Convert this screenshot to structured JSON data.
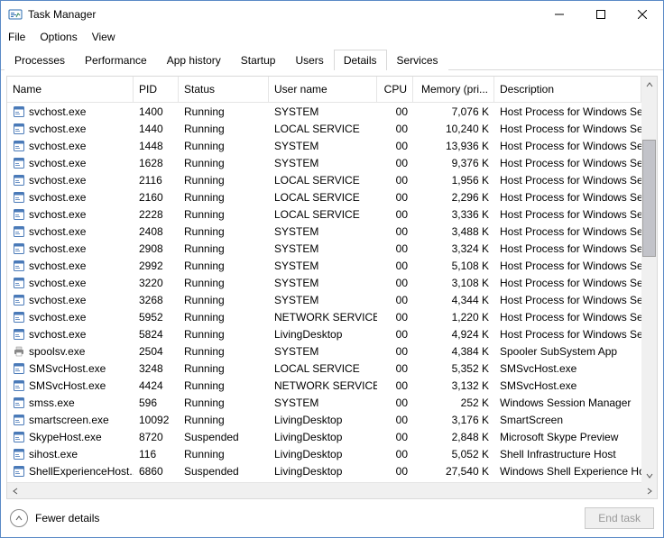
{
  "window": {
    "title": "Task Manager"
  },
  "menu": {
    "file": "File",
    "options": "Options",
    "view": "View"
  },
  "tabs": {
    "processes": "Processes",
    "performance": "Performance",
    "app_history": "App history",
    "startup": "Startup",
    "users": "Users",
    "details": "Details",
    "services": "Services"
  },
  "columns": {
    "name": "Name",
    "pid": "PID",
    "status": "Status",
    "user": "User name",
    "cpu": "CPU",
    "memory": "Memory (pri...",
    "description": "Description"
  },
  "rows": [
    {
      "icon": "exe",
      "name": "svchost.exe",
      "pid": "1400",
      "status": "Running",
      "user": "SYSTEM",
      "cpu": "00",
      "mem": "7,076 K",
      "desc": "Host Process for Windows Serv"
    },
    {
      "icon": "exe",
      "name": "svchost.exe",
      "pid": "1440",
      "status": "Running",
      "user": "LOCAL SERVICE",
      "cpu": "00",
      "mem": "10,240 K",
      "desc": "Host Process for Windows Serv"
    },
    {
      "icon": "exe",
      "name": "svchost.exe",
      "pid": "1448",
      "status": "Running",
      "user": "SYSTEM",
      "cpu": "00",
      "mem": "13,936 K",
      "desc": "Host Process for Windows Serv"
    },
    {
      "icon": "exe",
      "name": "svchost.exe",
      "pid": "1628",
      "status": "Running",
      "user": "SYSTEM",
      "cpu": "00",
      "mem": "9,376 K",
      "desc": "Host Process for Windows Serv"
    },
    {
      "icon": "exe",
      "name": "svchost.exe",
      "pid": "2116",
      "status": "Running",
      "user": "LOCAL SERVICE",
      "cpu": "00",
      "mem": "1,956 K",
      "desc": "Host Process for Windows Serv"
    },
    {
      "icon": "exe",
      "name": "svchost.exe",
      "pid": "2160",
      "status": "Running",
      "user": "LOCAL SERVICE",
      "cpu": "00",
      "mem": "2,296 K",
      "desc": "Host Process for Windows Serv"
    },
    {
      "icon": "exe",
      "name": "svchost.exe",
      "pid": "2228",
      "status": "Running",
      "user": "LOCAL SERVICE",
      "cpu": "00",
      "mem": "3,336 K",
      "desc": "Host Process for Windows Serv"
    },
    {
      "icon": "exe",
      "name": "svchost.exe",
      "pid": "2408",
      "status": "Running",
      "user": "SYSTEM",
      "cpu": "00",
      "mem": "3,488 K",
      "desc": "Host Process for Windows Serv"
    },
    {
      "icon": "exe",
      "name": "svchost.exe",
      "pid": "2908",
      "status": "Running",
      "user": "SYSTEM",
      "cpu": "00",
      "mem": "3,324 K",
      "desc": "Host Process for Windows Serv"
    },
    {
      "icon": "exe",
      "name": "svchost.exe",
      "pid": "2992",
      "status": "Running",
      "user": "SYSTEM",
      "cpu": "00",
      "mem": "5,108 K",
      "desc": "Host Process for Windows Serv"
    },
    {
      "icon": "exe",
      "name": "svchost.exe",
      "pid": "3220",
      "status": "Running",
      "user": "SYSTEM",
      "cpu": "00",
      "mem": "3,108 K",
      "desc": "Host Process for Windows Serv"
    },
    {
      "icon": "exe",
      "name": "svchost.exe",
      "pid": "3268",
      "status": "Running",
      "user": "SYSTEM",
      "cpu": "00",
      "mem": "4,344 K",
      "desc": "Host Process for Windows Serv"
    },
    {
      "icon": "exe",
      "name": "svchost.exe",
      "pid": "5952",
      "status": "Running",
      "user": "NETWORK SERVICE",
      "cpu": "00",
      "mem": "1,220 K",
      "desc": "Host Process for Windows Serv"
    },
    {
      "icon": "exe",
      "name": "svchost.exe",
      "pid": "5824",
      "status": "Running",
      "user": "LivingDesktop",
      "cpu": "00",
      "mem": "4,924 K",
      "desc": "Host Process for Windows Serv"
    },
    {
      "icon": "printer",
      "name": "spoolsv.exe",
      "pid": "2504",
      "status": "Running",
      "user": "SYSTEM",
      "cpu": "00",
      "mem": "4,384 K",
      "desc": "Spooler SubSystem App"
    },
    {
      "icon": "exe",
      "name": "SMSvcHost.exe",
      "pid": "3248",
      "status": "Running",
      "user": "LOCAL SERVICE",
      "cpu": "00",
      "mem": "5,352 K",
      "desc": "SMSvcHost.exe"
    },
    {
      "icon": "exe",
      "name": "SMSvcHost.exe",
      "pid": "4424",
      "status": "Running",
      "user": "NETWORK SERVICE",
      "cpu": "00",
      "mem": "3,132 K",
      "desc": "SMSvcHost.exe"
    },
    {
      "icon": "exe",
      "name": "smss.exe",
      "pid": "596",
      "status": "Running",
      "user": "SYSTEM",
      "cpu": "00",
      "mem": "252 K",
      "desc": "Windows Session Manager"
    },
    {
      "icon": "exe",
      "name": "smartscreen.exe",
      "pid": "10092",
      "status": "Running",
      "user": "LivingDesktop",
      "cpu": "00",
      "mem": "3,176 K",
      "desc": "SmartScreen"
    },
    {
      "icon": "exe",
      "name": "SkypeHost.exe",
      "pid": "8720",
      "status": "Suspended",
      "user": "LivingDesktop",
      "cpu": "00",
      "mem": "2,848 K",
      "desc": "Microsoft Skype Preview"
    },
    {
      "icon": "exe",
      "name": "sihost.exe",
      "pid": "116",
      "status": "Running",
      "user": "LivingDesktop",
      "cpu": "00",
      "mem": "5,052 K",
      "desc": "Shell Infrastructure Host"
    },
    {
      "icon": "exe",
      "name": "ShellExperienceHost....",
      "pid": "6860",
      "status": "Suspended",
      "user": "LivingDesktop",
      "cpu": "00",
      "mem": "27,540 K",
      "desc": "Windows Shell Experience Hos"
    }
  ],
  "footer": {
    "fewer": "Fewer details",
    "endtask": "End task"
  }
}
